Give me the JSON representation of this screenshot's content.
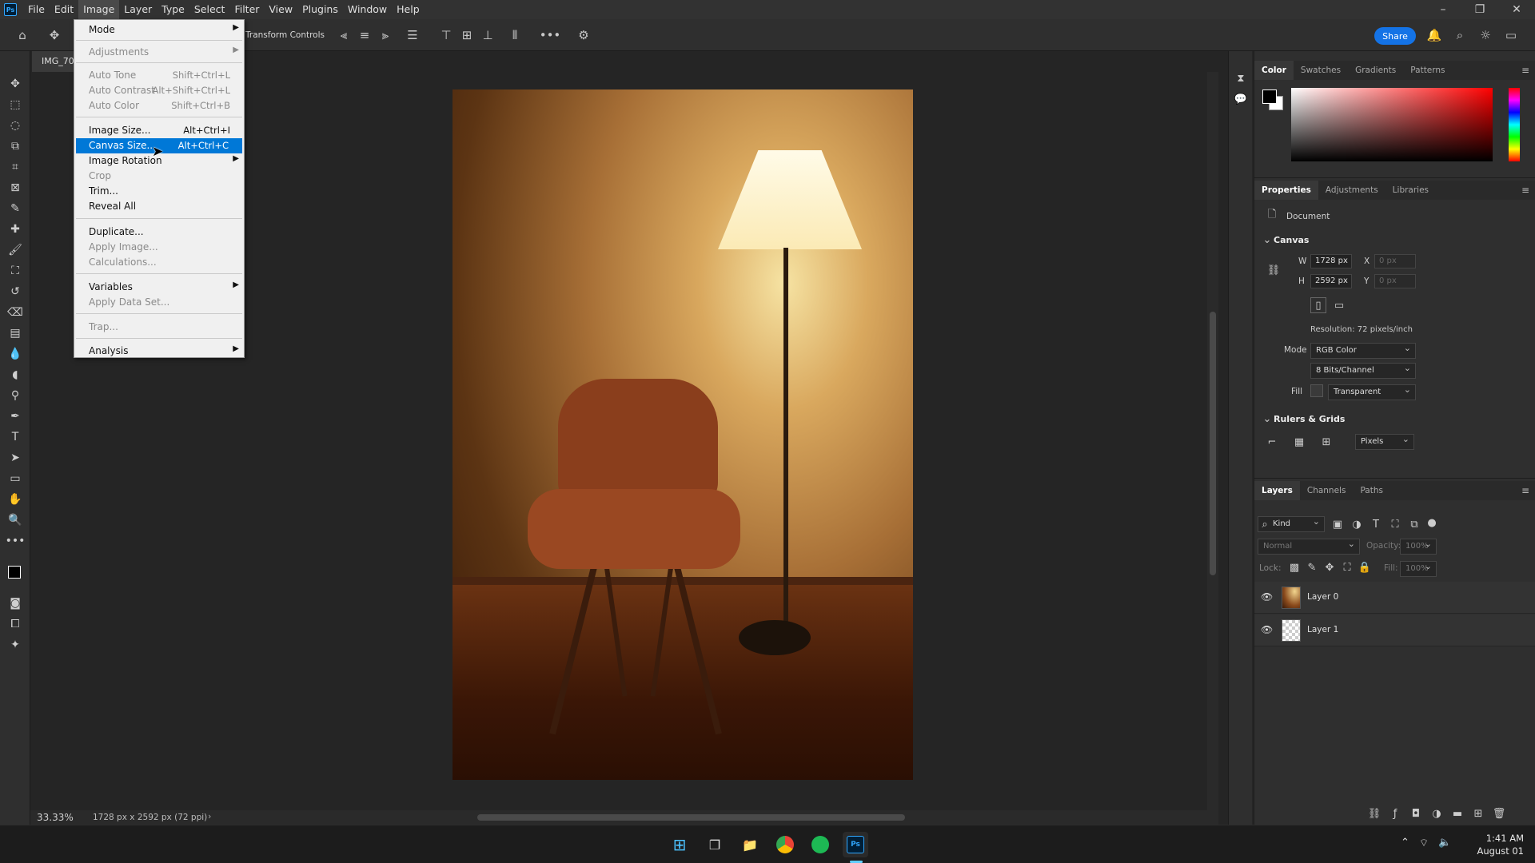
{
  "app": {
    "logo_text": "Ps"
  },
  "menubar": [
    "File",
    "Edit",
    "Image",
    "Layer",
    "Type",
    "Select",
    "Filter",
    "View",
    "Plugins",
    "Window",
    "Help"
  ],
  "window_controls": {
    "minimize": "–",
    "restore": "❐",
    "close": "✕"
  },
  "options_bar": {
    "transform_controls_label": "Transform Controls",
    "share_label": "Share"
  },
  "document": {
    "tab_title": "IMG_70",
    "zoom": "33.33%",
    "info": "1728 px x 2592 px (72 ppi)"
  },
  "image_menu": {
    "items": [
      {
        "label": "Mode",
        "shortcut": "",
        "submenu": true,
        "disabled": false
      },
      {
        "label": "Adjustments",
        "shortcut": "",
        "submenu": true,
        "disabled": true
      },
      {
        "label": "Auto Tone",
        "shortcut": "Shift+Ctrl+L",
        "submenu": false,
        "disabled": true
      },
      {
        "label": "Auto Contrast",
        "shortcut": "Alt+Shift+Ctrl+L",
        "submenu": false,
        "disabled": true
      },
      {
        "label": "Auto Color",
        "shortcut": "Shift+Ctrl+B",
        "submenu": false,
        "disabled": true
      },
      {
        "label": "Image Size...",
        "shortcut": "Alt+Ctrl+I",
        "submenu": false,
        "disabled": false
      },
      {
        "label": "Canvas Size...",
        "shortcut": "Alt+Ctrl+C",
        "submenu": false,
        "disabled": false,
        "highlighted": true
      },
      {
        "label": "Image Rotation",
        "shortcut": "",
        "submenu": true,
        "disabled": false
      },
      {
        "label": "Crop",
        "shortcut": "",
        "submenu": false,
        "disabled": true
      },
      {
        "label": "Trim...",
        "shortcut": "",
        "submenu": false,
        "disabled": false
      },
      {
        "label": "Reveal All",
        "shortcut": "",
        "submenu": false,
        "disabled": false
      },
      {
        "label": "Duplicate...",
        "shortcut": "",
        "submenu": false,
        "disabled": false
      },
      {
        "label": "Apply Image...",
        "shortcut": "",
        "submenu": false,
        "disabled": true
      },
      {
        "label": "Calculations...",
        "shortcut": "",
        "submenu": false,
        "disabled": true
      },
      {
        "label": "Variables",
        "shortcut": "",
        "submenu": true,
        "disabled": false
      },
      {
        "label": "Apply Data Set...",
        "shortcut": "",
        "submenu": false,
        "disabled": true
      },
      {
        "label": "Trap...",
        "shortcut": "",
        "submenu": false,
        "disabled": true
      },
      {
        "label": "Analysis",
        "shortcut": "",
        "submenu": true,
        "disabled": false
      }
    ]
  },
  "color_panel": {
    "tabs": [
      "Color",
      "Swatches",
      "Gradients",
      "Patterns"
    ],
    "foreground": "#000000",
    "background": "#ffffff"
  },
  "properties_panel": {
    "tabs": [
      "Properties",
      "Adjustments",
      "Libraries"
    ],
    "document_label": "Document",
    "canvas": {
      "section": "Canvas",
      "w_label": "W",
      "w_value": "1728 px",
      "h_label": "H",
      "h_value": "2592 px",
      "x_label": "X",
      "x_value": "0 px",
      "y_label": "Y",
      "y_value": "0 px",
      "resolution": "Resolution: 72 pixels/inch",
      "mode_label": "Mode",
      "mode_value": "RGB Color",
      "bits_value": "8 Bits/Channel",
      "fill_label": "Fill",
      "fill_value": "Transparent"
    },
    "rulers": {
      "section": "Rulers & Grids",
      "units": "Pixels"
    }
  },
  "layers_panel": {
    "tabs": [
      "Layers",
      "Channels",
      "Paths"
    ],
    "filter_kind": "Kind",
    "blend_mode": "Normal",
    "opacity_label": "Opacity:",
    "opacity_value": "100%",
    "lock_label": "Lock:",
    "fill_label": "Fill:",
    "fill_value": "100%",
    "layers": [
      {
        "name": "Layer 0",
        "visible": true
      },
      {
        "name": "Layer 1",
        "visible": true
      }
    ]
  },
  "taskbar": {
    "time": "1:41 AM",
    "date": "August 01"
  },
  "colors": {
    "accent": "#1473e6",
    "menu_highlight": "#0078d7"
  }
}
